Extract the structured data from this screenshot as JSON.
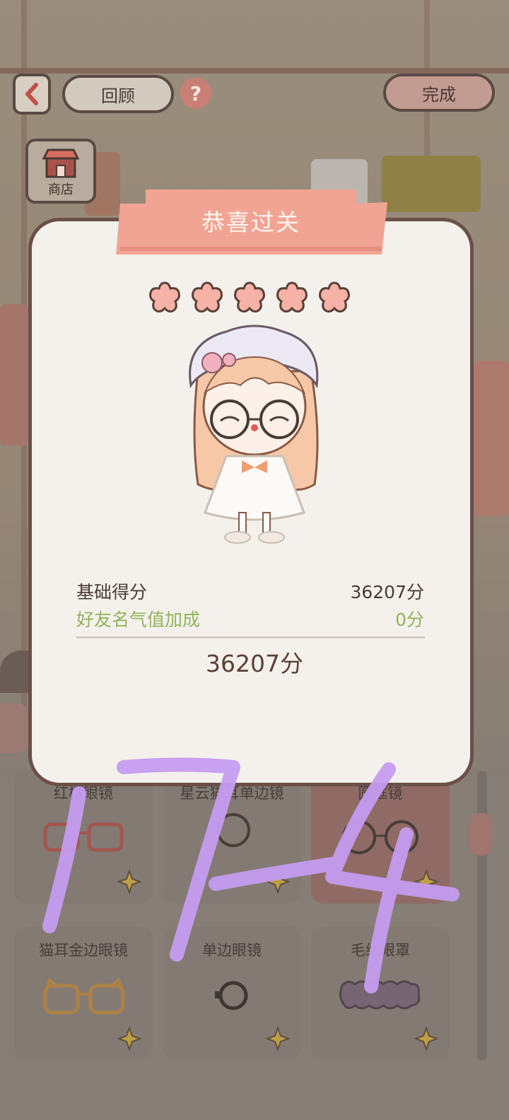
{
  "header": {
    "back_icon": "back-arrow-icon",
    "review_label": "回顾",
    "help_label": "?",
    "done_label": "完成",
    "shop_label": "商店"
  },
  "modal": {
    "title": "恭喜过关",
    "stars_filled": 5,
    "stars_total": 5,
    "base_score_label": "基础得分",
    "base_score_value": "36207分",
    "friend_bonus_label": "好友名气值加成",
    "friend_bonus_value": "0分",
    "total_value": "36207分"
  },
  "items": [
    {
      "title": "红框眼镜",
      "icon": "red-glasses-icon"
    },
    {
      "title": "星云猫耳单边镜",
      "icon": "monocle-icon"
    },
    {
      "title": "圆框镜",
      "icon": "round-glasses-icon"
    },
    {
      "title": "猫耳金边眼镜",
      "icon": "cat-ear-glasses-icon"
    },
    {
      "title": "单边眼镜",
      "icon": "monocle-icon"
    },
    {
      "title": "毛绒眼罩",
      "icon": "fluffy-eye-mask-icon"
    }
  ],
  "annotation": {
    "handwritten_text": "17-4"
  },
  "colors": {
    "accent": "#f0a496",
    "modal_bg": "#f4f1ec",
    "bonus_green": "#93b35a",
    "scribble": "#c59cf0"
  }
}
